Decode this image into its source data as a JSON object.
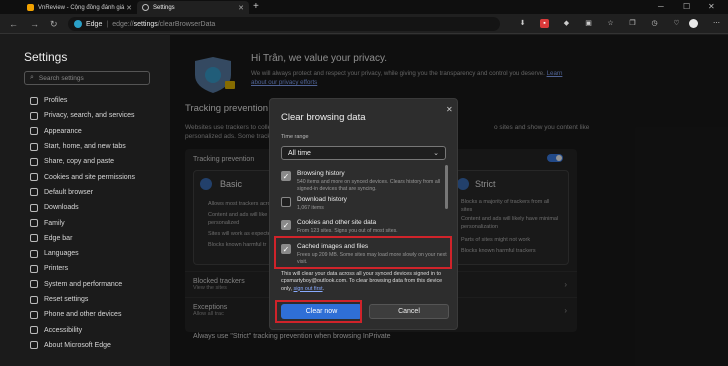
{
  "tabs": [
    {
      "label": "VnReview - Cộng đồng đánh giá",
      "active": false
    },
    {
      "label": "Settings",
      "active": true
    }
  ],
  "address": {
    "brand": "Edge",
    "url_prefix": "edge://",
    "url_main": "settings",
    "url_suffix": "/clearBrowserData"
  },
  "sidebar": {
    "title": "Settings",
    "search_placeholder": "Search settings",
    "items": [
      {
        "label": "Profiles"
      },
      {
        "label": "Privacy, search, and services"
      },
      {
        "label": "Appearance"
      },
      {
        "label": "Start, home, and new tabs"
      },
      {
        "label": "Share, copy and paste"
      },
      {
        "label": "Cookies and site permissions"
      },
      {
        "label": "Default browser"
      },
      {
        "label": "Downloads"
      },
      {
        "label": "Family"
      },
      {
        "label": "Edge bar"
      },
      {
        "label": "Languages"
      },
      {
        "label": "Printers"
      },
      {
        "label": "System and performance"
      },
      {
        "label": "Reset settings"
      },
      {
        "label": "Phone and other devices"
      },
      {
        "label": "Accessibility"
      },
      {
        "label": "About Microsoft Edge"
      }
    ]
  },
  "main": {
    "greeting": "Hi Trân, we value your privacy.",
    "greeting_sub": "We will always protect and respect your privacy, while giving you the transparency and control you deserve.",
    "learn_link": "Learn about our privacy efforts",
    "section_title": "Tracking prevention",
    "section_desc_left": "Websites use trackers to colle",
    "section_desc_right": "o sites and show you content like",
    "section_desc_line2": "personalized ads. Some track",
    "panel_label": "Tracking prevention",
    "cards": {
      "basic": {
        "title": "Basic",
        "bullets": [
          "Allows most trackers acros",
          "Content and ads will like",
          "personalized",
          "Sites will work as expected",
          "Blocks known harmful tr"
        ]
      },
      "strict": {
        "title": "Strict",
        "bullets": [
          "Blocks a majority of trackers from all sites",
          "Content and ads will likely have minimal personalization",
          "Parts of sites might not work",
          "Blocks known harmful trackers"
        ]
      }
    },
    "blocked_trackers": "Blocked trackers",
    "blocked_sub": "View the sites",
    "exceptions": "Exceptions",
    "exceptions_sub": "Allow all trac",
    "strict_inprivate": "Always use \"Strict\" tracking prevention when browsing InPrivate"
  },
  "dialog": {
    "title": "Clear browsing data",
    "time_range_label": "Time range",
    "time_range_value": "All time",
    "options": [
      {
        "title": "Browsing history",
        "desc": "540 items and more on synced devices. Clears history from all signed-in devices that are syncing.",
        "checked": true
      },
      {
        "title": "Download history",
        "desc": "1,067 items",
        "checked": false
      },
      {
        "title": "Cookies and other site data",
        "desc": "From 123 sites. Signs you out of most sites.",
        "checked": true
      },
      {
        "title": "Cached images and files",
        "desc": "Frees up 209 MB. Some sites may load more slowly on your next visit.",
        "checked": true
      }
    ],
    "info_text": "This will clear your data across all your synced devices signed in to cpsmartyboy@outlook.com. To clear browsing data from this device only,",
    "sign_out_link": "sign out first",
    "clear_label": "Clear now",
    "cancel_label": "Cancel"
  },
  "colors": {
    "accent": "#2f6fd6",
    "highlight": "#d0232a"
  }
}
